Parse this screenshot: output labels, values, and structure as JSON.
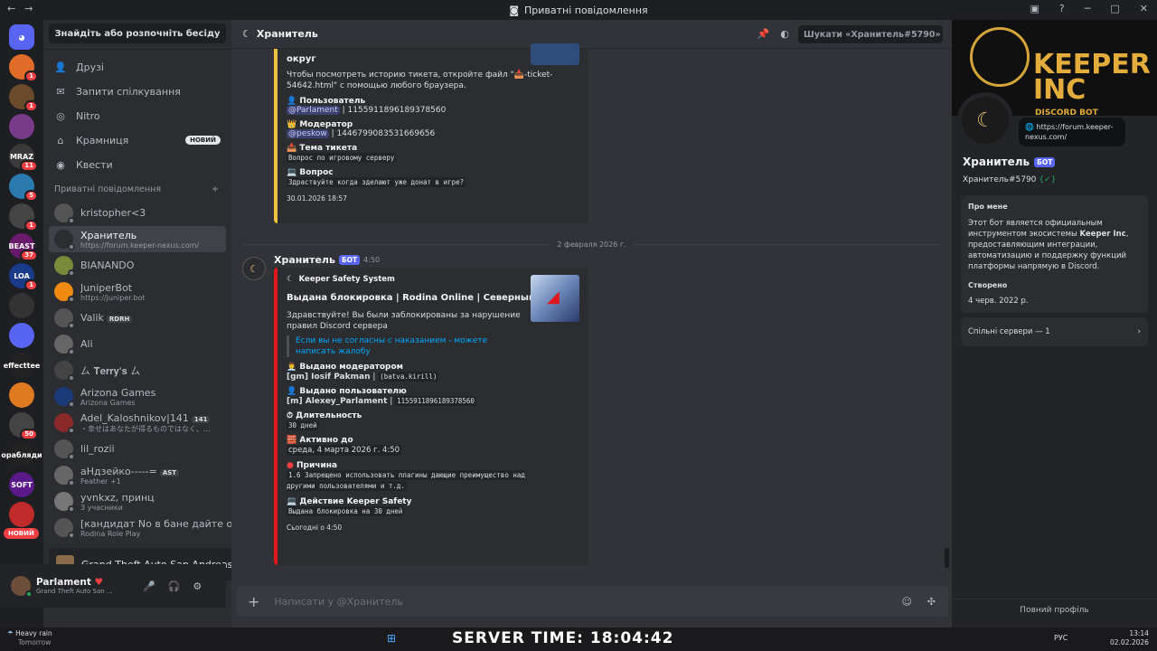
{
  "titlebar": {
    "title": "Приватні повідомлення"
  },
  "guilds": [
    {
      "label": "",
      "badge": ""
    },
    {
      "label": "",
      "badge": "1"
    },
    {
      "label": "",
      "badge": "1"
    },
    {
      "label": "",
      "badge": ""
    },
    {
      "label": "MRAZ",
      "badge": "11"
    },
    {
      "label": "",
      "badge": "5"
    },
    {
      "label": "",
      "badge": "1"
    },
    {
      "label": "BEAST",
      "badge": "37"
    },
    {
      "label": "LOA",
      "badge": "1"
    },
    {
      "label": "",
      "badge": ""
    },
    {
      "label": "",
      "badge": ""
    },
    {
      "label": "effecttee",
      "badge": ""
    },
    {
      "label": "",
      "badge": ""
    },
    {
      "label": "",
      "badge": "50"
    },
    {
      "label": "орабляди",
      "badge": ""
    },
    {
      "label": "SOFT",
      "badge": ""
    },
    {
      "label": "",
      "badge": ""
    }
  ],
  "guild_new": "НОВИЙ",
  "sidebar": {
    "search": "Знайдіть або розпочніть бесіду",
    "nav": [
      {
        "label": "Друзі"
      },
      {
        "label": "Запити спілкування"
      },
      {
        "label": "Nitro"
      },
      {
        "label": "Крамниця",
        "badge": "НОВИЙ"
      },
      {
        "label": "Квести"
      }
    ],
    "dm_header": "Приватні повідомлення",
    "dms": [
      {
        "name": "kristopher<3",
        "sub": ""
      },
      {
        "name": "Хранитель",
        "sub": "https://forum.keeper-nexus.com/"
      },
      {
        "name": "BIANANDO",
        "sub": ""
      },
      {
        "name": "JuniperBot",
        "sub": "https://juniper.bot"
      },
      {
        "name": "Valik",
        "sub": "",
        "tag": "RDRH"
      },
      {
        "name": "Ali",
        "sub": ""
      },
      {
        "name": "ㄙ 𝐓𝐞𝐫𝐫𝐲'𝐬 ㄙ",
        "sub": ""
      },
      {
        "name": "Arizona Games",
        "sub": "Arizona Games"
      },
      {
        "name": "Adel_Kaloshnikov|141",
        "sub": "・幸せはあなたが得るものではなく、...",
        "tag": "141"
      },
      {
        "name": "lil_rozii",
        "sub": ""
      },
      {
        "name": "аНдзейко-----=",
        "sub": "Feather +1",
        "tag": "AST"
      },
      {
        "name": "yvnkxz, принц",
        "sub": "3 учасники"
      },
      {
        "name": "[кандидат No в бане дайте обз...",
        "sub": "Rodina Role Play"
      }
    ],
    "activity": "Grand Theft Auto San Andreas",
    "user": {
      "name": "Parlament",
      "status": "Grand Theft Auto San ..."
    }
  },
  "chat": {
    "header": "Хранитель",
    "search_placeholder": "Шукати «Хранитель#5790»",
    "embed1": {
      "title_tail": "округ",
      "desc": "Чтобы посмотреть историю тикета, откройте файл \"📥-ticket-54642.html\" с помощью любого браузера.",
      "f_user": "Пользователь",
      "f_user_val_mention": "@Parlament",
      "f_user_val": " | 1155911896189378560",
      "f_mod": "Модератор",
      "f_mod_val_mention": "@peskow",
      "f_mod_val": " | 1446799083531669656",
      "f_topic": "Тема тикета",
      "f_topic_val": "Вопрос по игровому серверу",
      "f_q": "Вопрос",
      "f_q_val": "Здраствуйте когда зделают уже донат в игре?",
      "footer": "30.01.2026 18:57"
    },
    "date_sep": "2 февраля 2026 г.",
    "msg": {
      "author": "Хранитель",
      "bot": "БОТ",
      "time": "4:50"
    },
    "embed2": {
      "author": "Keeper Safety System",
      "title": "Выдана блокировка | Rodina Online | Северный округ",
      "desc": "Здравствуйте! Вы были заблокированы за нарушение правил Discord сервера",
      "quote": "Если вы не согласны с наказанием - можете написать жалобу",
      "f1": "Выдано модератором",
      "f1_val": "[gm] Iosif Pakman",
      "f1_code": "(batva.kirill)",
      "f2": "Выдано пользователю",
      "f2_val": "[m] Alexey_Parlament",
      "f2_code": "1155911896189378560",
      "f3": "Длительность",
      "f3_code": "30 дней",
      "f4": "Активно до",
      "f4_val": "среда, 4 марта 2026 г. 4:50",
      "f5": "Причина",
      "f5_code": "1.6 Запрещено использовать плагины дающие преимущество над другими пользователями и т.д.",
      "f6": "Действие Keeper Safety",
      "f6_code": "Выдана блокировка на 30 дней",
      "footer": "Сьогодні о 4:50"
    },
    "input_placeholder": "Написати у @Хранитель"
  },
  "profile": {
    "banner1": "KEEPER",
    "banner2": "INC",
    "banner3": "DISCORD BOT",
    "link": "https://forum.keeper-nexus.com/",
    "name": "Хранитель",
    "bot": "БОТ",
    "tag": "Хранитель#5790",
    "about_h": "Про мене",
    "about_pre": "Этот бот является официальным инструментом экосистемы ",
    "about_bold": "Keeper Inc",
    "about_post": ", предоставляющим интеграции, автоматизацию и поддержку функций платформы напрямую в Discord.",
    "created_h": "Створено",
    "created": "4 черв. 2022 р.",
    "servers": "Спільні сервери — 1",
    "full": "Повний профіль"
  },
  "taskbar": {
    "weather1": "Heavy rain",
    "weather2": "Tomorrow",
    "lang": "РУС",
    "time": "13:14",
    "date": "02.02.2026",
    "server": "SERVER TIME: 18:04:42"
  },
  "colors": {
    "accent": "#5865f2",
    "embed1": "#f0c040",
    "embed2": "#e0161b"
  }
}
